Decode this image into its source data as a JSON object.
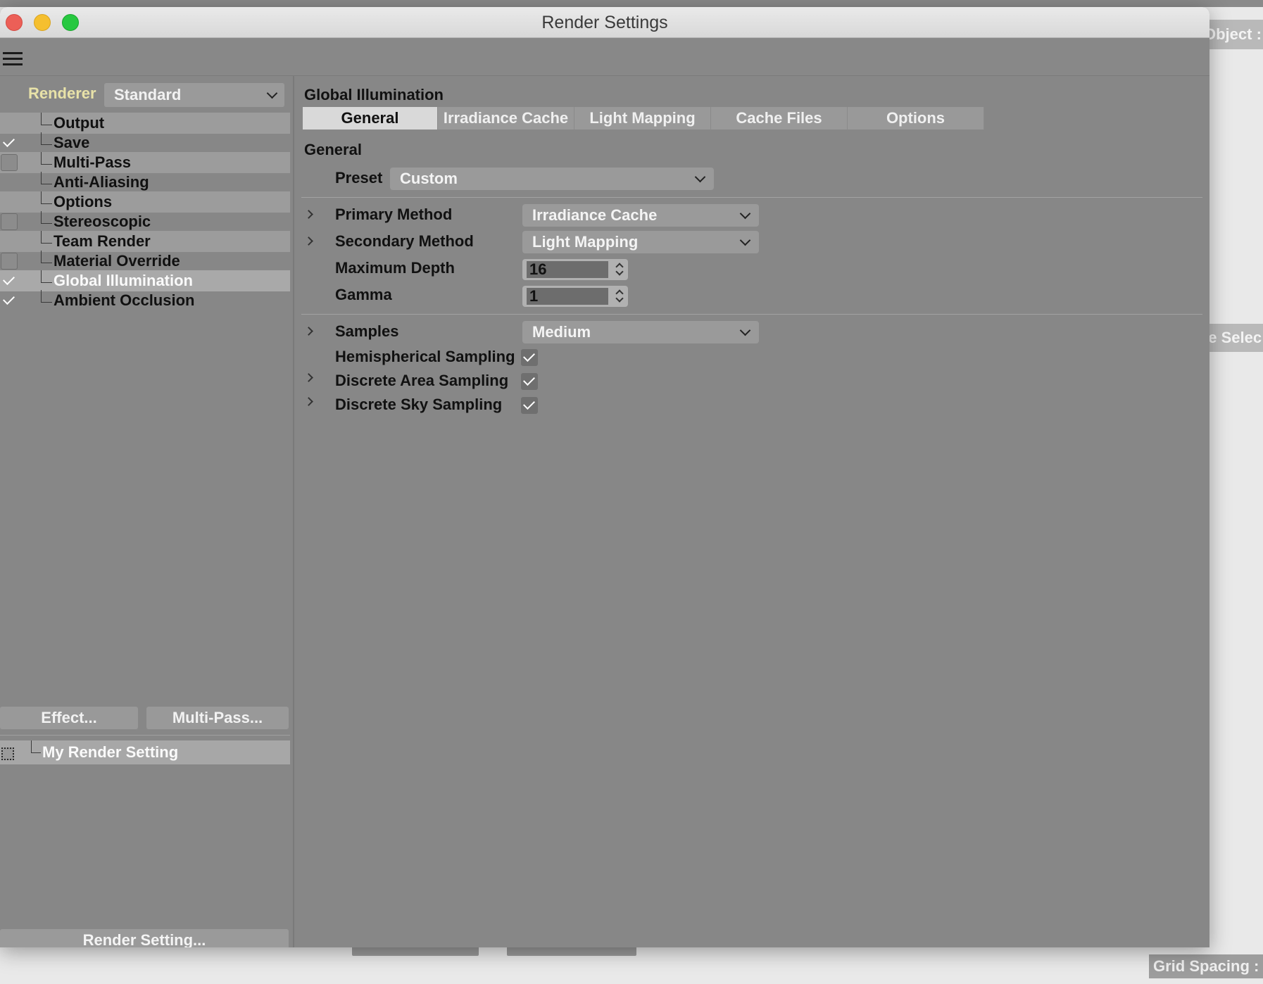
{
  "background": {
    "right_header": "Object :",
    "right_selection": "ve Selec",
    "grid_spacing": "Grid Spacing :"
  },
  "window": {
    "title": "Render Settings"
  },
  "sidebar": {
    "renderer_label": "Renderer",
    "renderer_value": "Standard",
    "items": [
      {
        "label": "Output",
        "checkbox": "none"
      },
      {
        "label": "Save",
        "checkbox": "checked"
      },
      {
        "label": "Multi-Pass",
        "checkbox": "unchecked"
      },
      {
        "label": "Anti-Aliasing",
        "checkbox": "none"
      },
      {
        "label": "Options",
        "checkbox": "none"
      },
      {
        "label": "Stereoscopic",
        "checkbox": "unchecked"
      },
      {
        "label": "Team Render",
        "checkbox": "none"
      },
      {
        "label": "Material Override",
        "checkbox": "unchecked"
      },
      {
        "label": "Global Illumination",
        "checkbox": "checked"
      },
      {
        "label": "Ambient Occlusion",
        "checkbox": "checked"
      }
    ],
    "effect_button": "Effect...",
    "multipass_button": "Multi-Pass...",
    "render_setting_name": "My Render Setting",
    "render_setting_button": "Render Setting..."
  },
  "main": {
    "section_title": "Global Illumination",
    "tabs": [
      "General",
      "Irradiance Cache",
      "Light Mapping",
      "Cache Files",
      "Options"
    ],
    "active_tab": "General",
    "group_title": "General",
    "preset_label": "Preset",
    "preset_value": "Custom",
    "primary_method_label": "Primary Method",
    "primary_method_value": "Irradiance Cache",
    "secondary_method_label": "Secondary Method",
    "secondary_method_value": "Light Mapping",
    "max_depth_label": "Maximum Depth",
    "max_depth_value": "16",
    "gamma_label": "Gamma",
    "gamma_value": "1",
    "samples_label": "Samples",
    "samples_value": "Medium",
    "hemispherical_label": "Hemispherical Sampling",
    "discrete_area_label": "Discrete Area Sampling",
    "discrete_sky_label": "Discrete Sky Sampling"
  }
}
